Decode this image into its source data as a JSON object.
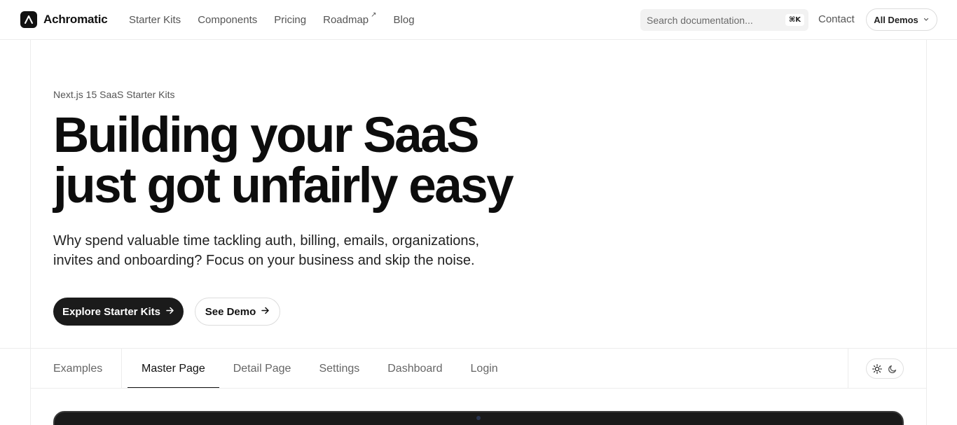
{
  "header": {
    "brand": "Achromatic",
    "nav": [
      {
        "label": "Starter Kits"
      },
      {
        "label": "Components"
      },
      {
        "label": "Pricing"
      },
      {
        "label": "Roadmap",
        "external": true
      },
      {
        "label": "Blog"
      }
    ],
    "search": {
      "placeholder": "Search documentation...",
      "shortcut": "⌘K"
    },
    "contact": "Contact",
    "demos_label": "All Demos"
  },
  "hero": {
    "eyebrow": "Next.js 15 SaaS Starter Kits",
    "headline_line1": "Building your SaaS",
    "headline_line2": "just got unfairly easy",
    "subtext": "Why spend valuable time tackling auth, billing, emails, organizations, invites and onboarding? Focus on your business and skip the noise.",
    "primary_cta": "Explore Starter Kits",
    "secondary_cta": "See Demo"
  },
  "examples": {
    "label": "Examples",
    "tabs": [
      {
        "label": "Master Page",
        "active": true
      },
      {
        "label": "Detail Page"
      },
      {
        "label": "Settings"
      },
      {
        "label": "Dashboard"
      },
      {
        "label": "Login"
      }
    ],
    "theme_options": [
      "sun-icon",
      "moon-icon"
    ]
  }
}
